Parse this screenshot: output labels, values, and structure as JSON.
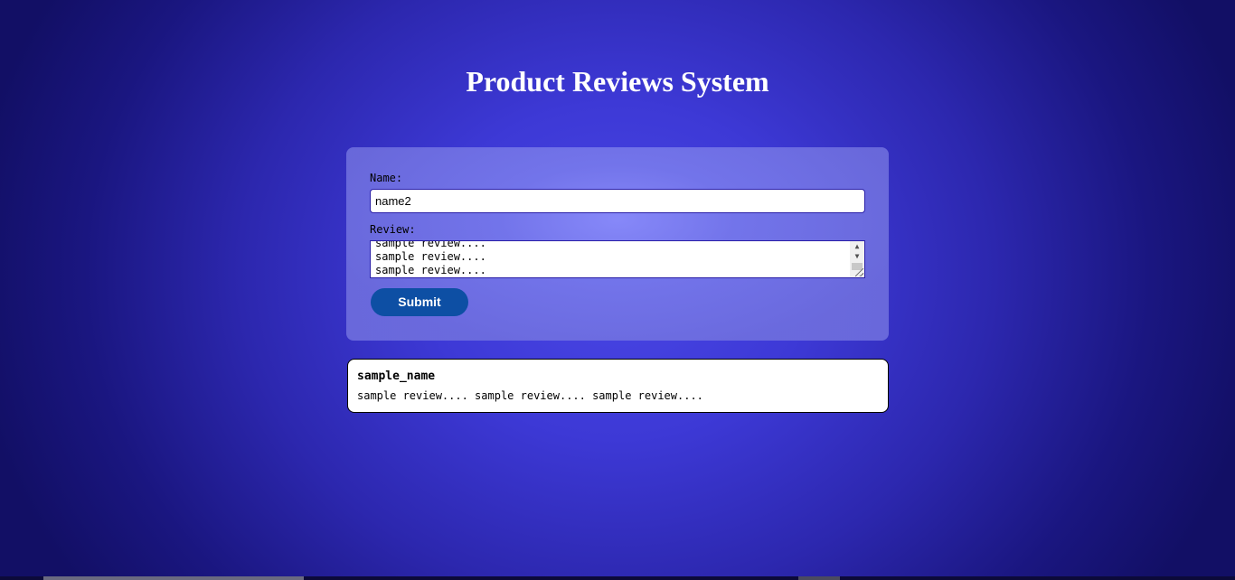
{
  "page": {
    "title": "Product Reviews System"
  },
  "form": {
    "name_label": "Name:",
    "name_value": "name2",
    "review_label": "Review:",
    "review_value": "sample review....\nsample review....\nsample review....",
    "submit_label": "Submit"
  },
  "reviews": [
    {
      "name": "sample_name",
      "text": "sample review.... sample review.... sample review...."
    }
  ],
  "colors": {
    "background": "#3d39d6",
    "form_card": "#7a7cec",
    "submit_button": "#0d4fa4",
    "input_border": "#2a1fa8"
  },
  "icons": {
    "scroll_up": "scroll-up-arrow-icon",
    "scroll_down": "scroll-down-arrow-icon",
    "resize": "resize-grip-icon"
  }
}
